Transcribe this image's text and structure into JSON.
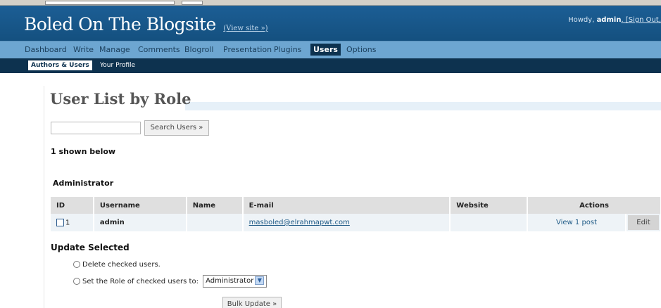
{
  "header": {
    "blog_title": "Boled On The Blogsite",
    "view_site": "(View site »)",
    "howdy_prefix": "Howdy, ",
    "user": "admin",
    "signout": ". [Sign Out,"
  },
  "menu": {
    "items": [
      "Dashboard",
      "Write",
      "Manage",
      "Comments",
      "Blogroll",
      "Presentation",
      "Plugins",
      "Users",
      "Options"
    ],
    "active": "Users"
  },
  "submenu": {
    "items": [
      "Authors & Users",
      "Your Profile"
    ],
    "active": "Authors & Users"
  },
  "page": {
    "title": "User List by Role",
    "search_button": "Search Users »",
    "shown_below": "1 shown below",
    "role_heading": "Administrator"
  },
  "table": {
    "headers": [
      "ID",
      "Username",
      "Name",
      "E-mail",
      "Website",
      "Actions"
    ],
    "rows": [
      {
        "id": "1",
        "username": "admin",
        "name": "",
        "email": "masboled@elrahmapwt.com",
        "website": "",
        "view_posts": "View 1 post",
        "edit": "Edit"
      }
    ]
  },
  "update": {
    "heading": "Update Selected",
    "delete_option": "Delete checked users.",
    "set_role_option": "Set the Role of checked users to:",
    "selected_role": "Administrator",
    "bulk_button": "Bulk Update »"
  }
}
